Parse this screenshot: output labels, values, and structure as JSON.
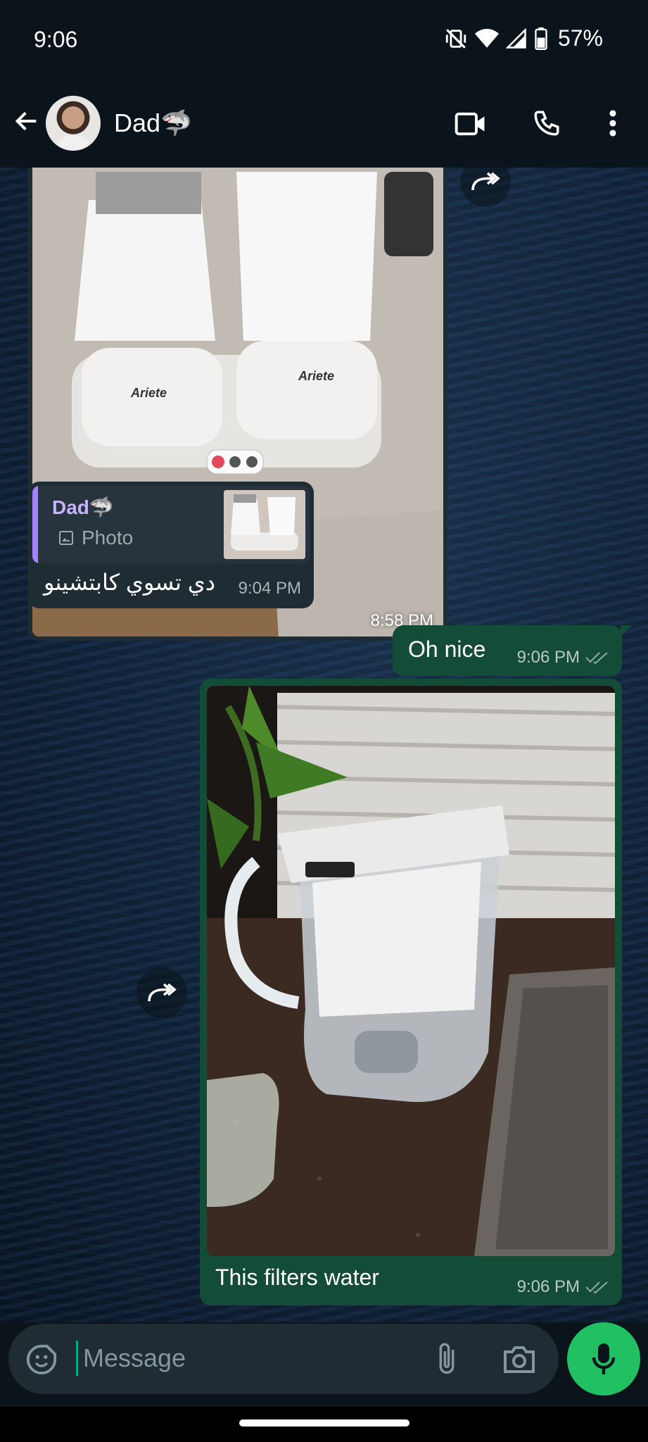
{
  "status": {
    "time": "9:06",
    "battery": "57%"
  },
  "header": {
    "contact": "Dad🦈"
  },
  "messages": {
    "img1_time": "8:58 PM",
    "reply": {
      "quoted_name": "Dad🦈",
      "quoted_type": "Photo",
      "text": "دي تسوي كابتشينو",
      "time": "9:04 PM"
    },
    "out1": {
      "text": "Oh nice",
      "time": "9:06 PM"
    },
    "out2": {
      "caption": "This filters water",
      "time": "9:06 PM"
    },
    "brand_label": "Ariete"
  },
  "input": {
    "placeholder": "Message"
  },
  "colors": {
    "accent": "#21c063",
    "outgoing": "#144d37",
    "incoming": "#1f2c34"
  }
}
